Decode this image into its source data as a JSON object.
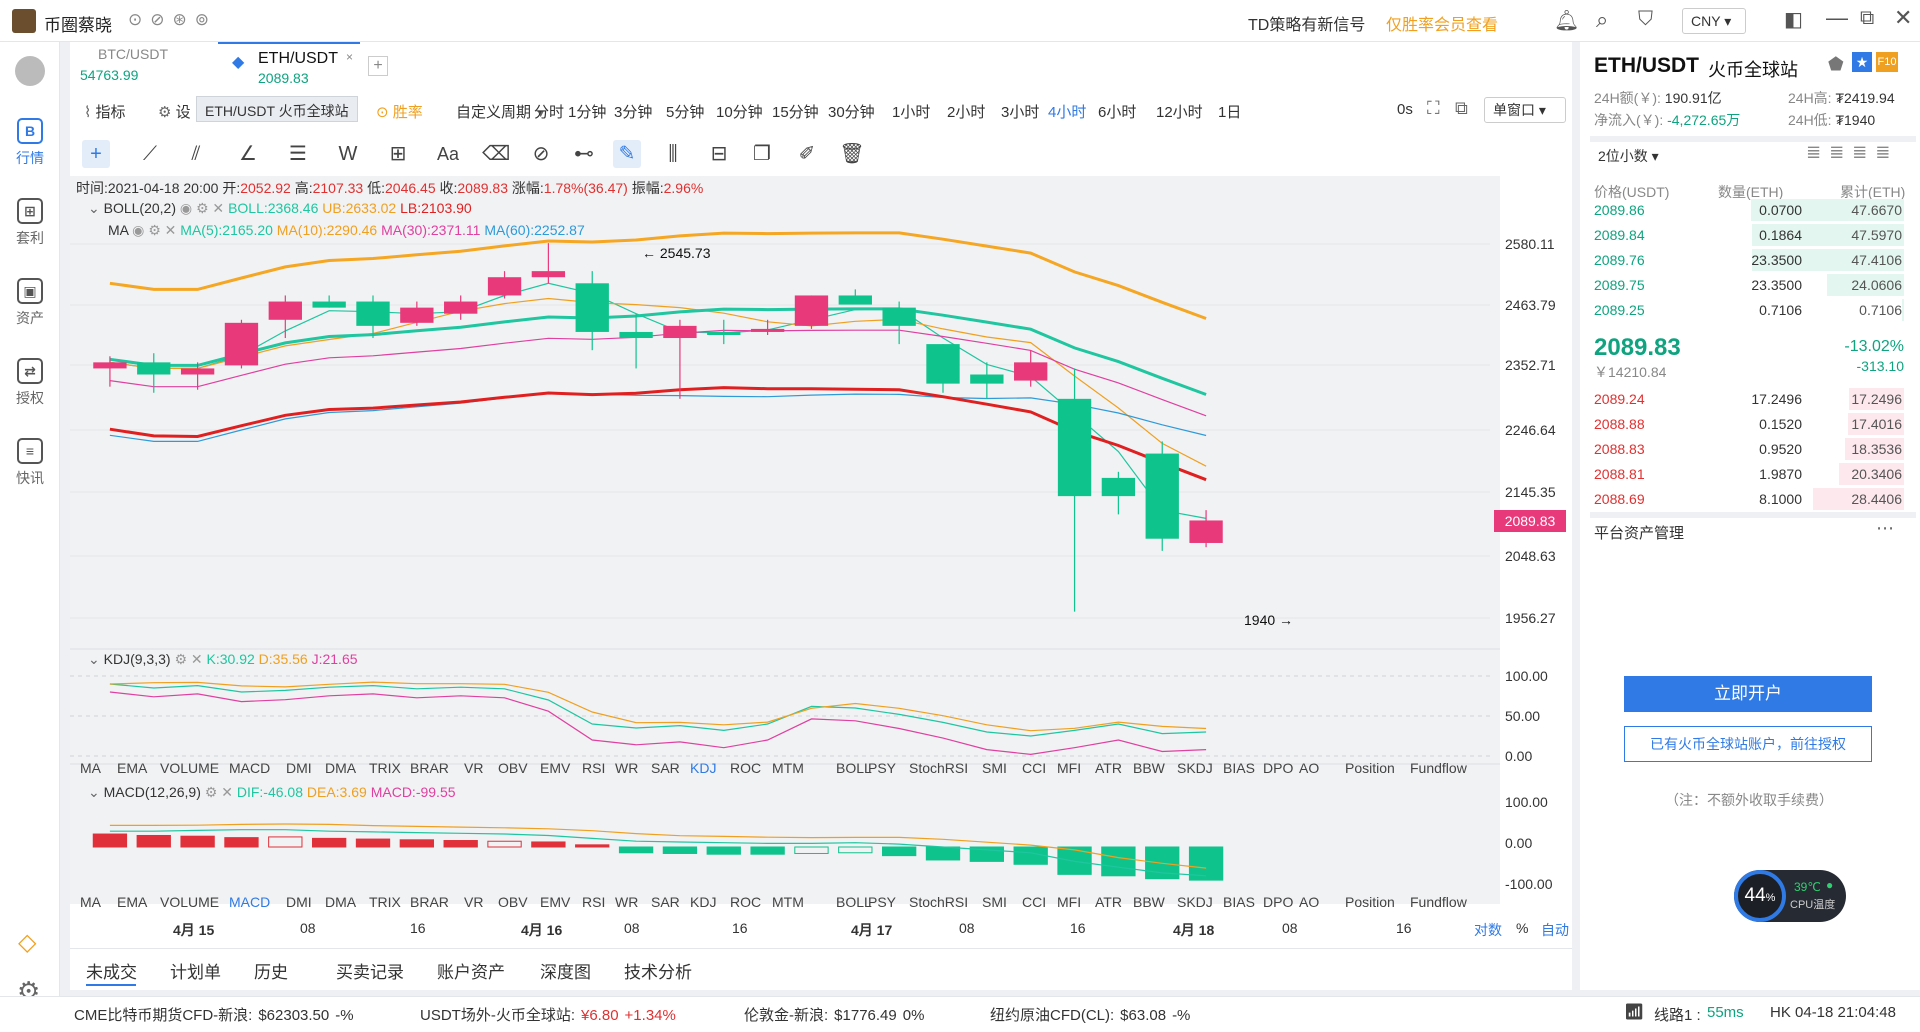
{
  "app": {
    "title": "币圈蔡晓",
    "signal_text": "TD策略有新信号",
    "vip_text": "仅胜率会员查看",
    "currency": "CNY"
  },
  "sidebar": {
    "items": [
      {
        "label": "行情",
        "glyph": "B"
      },
      {
        "label": "套利",
        "glyph": "⊞"
      },
      {
        "label": "资产",
        "glyph": "▣"
      },
      {
        "label": "授权",
        "glyph": "⇄"
      },
      {
        "label": "快讯",
        "glyph": "≡"
      }
    ]
  },
  "tabs": [
    {
      "symbol": "BTC/USDT",
      "price": "54763.99"
    },
    {
      "symbol": "ETH/USDT",
      "price": "2089.83"
    }
  ],
  "toolbar": {
    "indicator": "指标",
    "settings": "设",
    "tooltip": "ETH/USDT 火币全球站",
    "winrate": "胜率",
    "custom_period": "自定义周期",
    "periods": [
      "分时",
      "1分钟",
      "3分钟",
      "5分钟",
      "10分钟",
      "15分钟",
      "30分钟",
      "1小时",
      "2小时",
      "3小时",
      "4小时",
      "6小时",
      "12小时",
      "1日"
    ],
    "active_period": "4小时",
    "countdown": "0s",
    "window_mode": "单窗口"
  },
  "ohlc": {
    "time_label": "时间:",
    "time": "2021-04-18 20:00",
    "open_label": "开:",
    "open": "2052.92",
    "high_label": "高:",
    "high": "2107.33",
    "low_label": "低:",
    "low": "2046.45",
    "close_label": "收:",
    "close": "2089.83",
    "chg_label": "涨幅:",
    "chg": "1.78%(36.47)",
    "amp_label": "振幅:",
    "amp": "2.96%"
  },
  "boll": {
    "name": "BOLL(20,2)",
    "boll": "BOLL:2368.46",
    "ub": "UB:2633.02",
    "lb": "LB:2103.90"
  },
  "ma": {
    "name": "MA",
    "ma5": "MA(5):2165.20",
    "ma10": "MA(10):2290.46",
    "ma30": "MA(30):2371.11",
    "ma60": "MA(60):2252.87"
  },
  "kdj": {
    "name": "KDJ(9,3,3)",
    "k": "K:30.92",
    "d": "D:35.56",
    "j": "J:21.65"
  },
  "macd": {
    "name": "MACD(12,26,9)",
    "dif": "DIF:-46.08",
    "dea": "DEA:3.69",
    "macd": "MACD:-99.55"
  },
  "price_axis": [
    "2580.11",
    "2463.79",
    "2352.71",
    "2246.64",
    "2145.35",
    "2048.63",
    "1956.27"
  ],
  "current_price_tag": "2089.83",
  "high_marker": "← 2545.73",
  "low_marker": "1940 →",
  "kdj_axis": [
    "100.00",
    "50.00",
    "0.00"
  ],
  "macd_axis": [
    "100.00",
    "0.00",
    "-100.00"
  ],
  "indicator_tabs": [
    "MA",
    "EMA",
    "VOLUME",
    "MACD",
    "DMI",
    "DMA",
    "TRIX",
    "BRAR",
    "VR",
    "OBV",
    "EMV",
    "RSI",
    "WR",
    "SAR",
    "KDJ",
    "ROC",
    "MTM",
    "BOLL",
    "PSY",
    "StochRSI",
    "SMI",
    "CCI",
    "MFI",
    "ATR",
    "BBW",
    "SKDJ",
    "BIAS",
    "DPO",
    "AO",
    "Position",
    "Fundflow"
  ],
  "time_axis": [
    "4月 15",
    "08",
    "16",
    "4月 16",
    "08",
    "16",
    "4月 17",
    "08",
    "16",
    "4月 18",
    "08",
    "16"
  ],
  "axis_options": [
    "对数",
    "%",
    "自动"
  ],
  "bottom_tabs": [
    "未成交",
    "计划单",
    "历史",
    "买卖记录",
    "账户资产",
    "深度图",
    "技术分析"
  ],
  "right": {
    "symbol": "ETH/USDT",
    "exchange": "火币全球站",
    "vol24_label": "24H额(￥):",
    "vol24": "190.91亿",
    "high24_label": "24H高:",
    "high24": "₮2419.94",
    "inflow_label": "净流入(￥):",
    "inflow": "-4,272.65万",
    "low24_label": "24H低:",
    "low24": "₮1940",
    "decimals": "2位小数",
    "col_price": "价格(USDT)",
    "col_amount": "数量(ETH)",
    "col_total": "累计(ETH)",
    "asks": [
      [
        "2089.86",
        "0.0700",
        "47.6670"
      ],
      [
        "2089.84",
        "0.1864",
        "47.5970"
      ],
      [
        "2089.76",
        "23.3500",
        "47.4106"
      ],
      [
        "2089.75",
        "23.3500",
        "24.0606"
      ],
      [
        "2089.25",
        "0.7106",
        "0.7106"
      ]
    ],
    "last_price": "2089.83",
    "last_cny": "￥14210.84",
    "change_pct": "-13.02%",
    "change_abs": "-313.10",
    "bids": [
      [
        "2089.24",
        "17.2496",
        "17.2496"
      ],
      [
        "2088.88",
        "0.1520",
        "17.4016"
      ],
      [
        "2088.83",
        "0.9520",
        "18.3536"
      ],
      [
        "2088.81",
        "1.9870",
        "20.3406"
      ],
      [
        "2088.69",
        "8.1000",
        "28.4406"
      ]
    ],
    "asset_title": "平台资产管理",
    "open_btn": "立即开户",
    "auth_btn": "已有火币全球站账户，前往授权",
    "note": "（注：不额外收取手续费）",
    "cpu_pct": "44",
    "cpu_temp": "39℃",
    "cpu_label": "CPU温度"
  },
  "status": [
    {
      "label": "CME比特币期货CFD-新浪:",
      "value": "$62303.50",
      "chg": "-%"
    },
    {
      "label": "USDT场外-火币全球站:",
      "value": "¥6.80",
      "chg": "+1.34%"
    },
    {
      "label": "伦敦金-新浪:",
      "value": "$1776.49",
      "chg": "0%"
    },
    {
      "label": "纽约原油CFD(CL):",
      "value": "$63.08",
      "chg": "-%"
    }
  ],
  "network": {
    "line": "线路1 :",
    "ping": "55ms",
    "clock": "HK 04-18 21:04:48"
  },
  "chart_data": {
    "type": "candlestick",
    "interval": "4小时",
    "ylim": [
      1900,
      2640
    ],
    "candles": [
      [
        2340,
        2360,
        2310,
        2350
      ],
      [
        2350,
        2365,
        2300,
        2330
      ],
      [
        2330,
        2350,
        2305,
        2340
      ],
      [
        2345,
        2420,
        2340,
        2415
      ],
      [
        2420,
        2460,
        2390,
        2450
      ],
      [
        2450,
        2460,
        2440,
        2440
      ],
      [
        2450,
        2460,
        2390,
        2410
      ],
      [
        2415,
        2450,
        2410,
        2440
      ],
      [
        2430,
        2460,
        2420,
        2450
      ],
      [
        2460,
        2500,
        2455,
        2490
      ],
      [
        2490,
        2546,
        2480,
        2500
      ],
      [
        2480,
        2500,
        2370,
        2400
      ],
      [
        2400,
        2430,
        2340,
        2390
      ],
      [
        2390,
        2420,
        2290,
        2410
      ],
      [
        2400,
        2420,
        2380,
        2395
      ],
      [
        2400,
        2420,
        2395,
        2405
      ],
      [
        2410,
        2460,
        2405,
        2460
      ],
      [
        2460,
        2470,
        2450,
        2445
      ],
      [
        2440,
        2450,
        2380,
        2410
      ],
      [
        2380,
        2380,
        2300,
        2315
      ],
      [
        2330,
        2350,
        2290,
        2315
      ],
      [
        2320,
        2370,
        2310,
        2350
      ],
      [
        2290,
        2340,
        1940,
        2130
      ],
      [
        2160,
        2170,
        2100,
        2130
      ],
      [
        2200,
        2220,
        2040,
        2060
      ],
      [
        2053,
        2107,
        2046,
        2090
      ]
    ]
  }
}
